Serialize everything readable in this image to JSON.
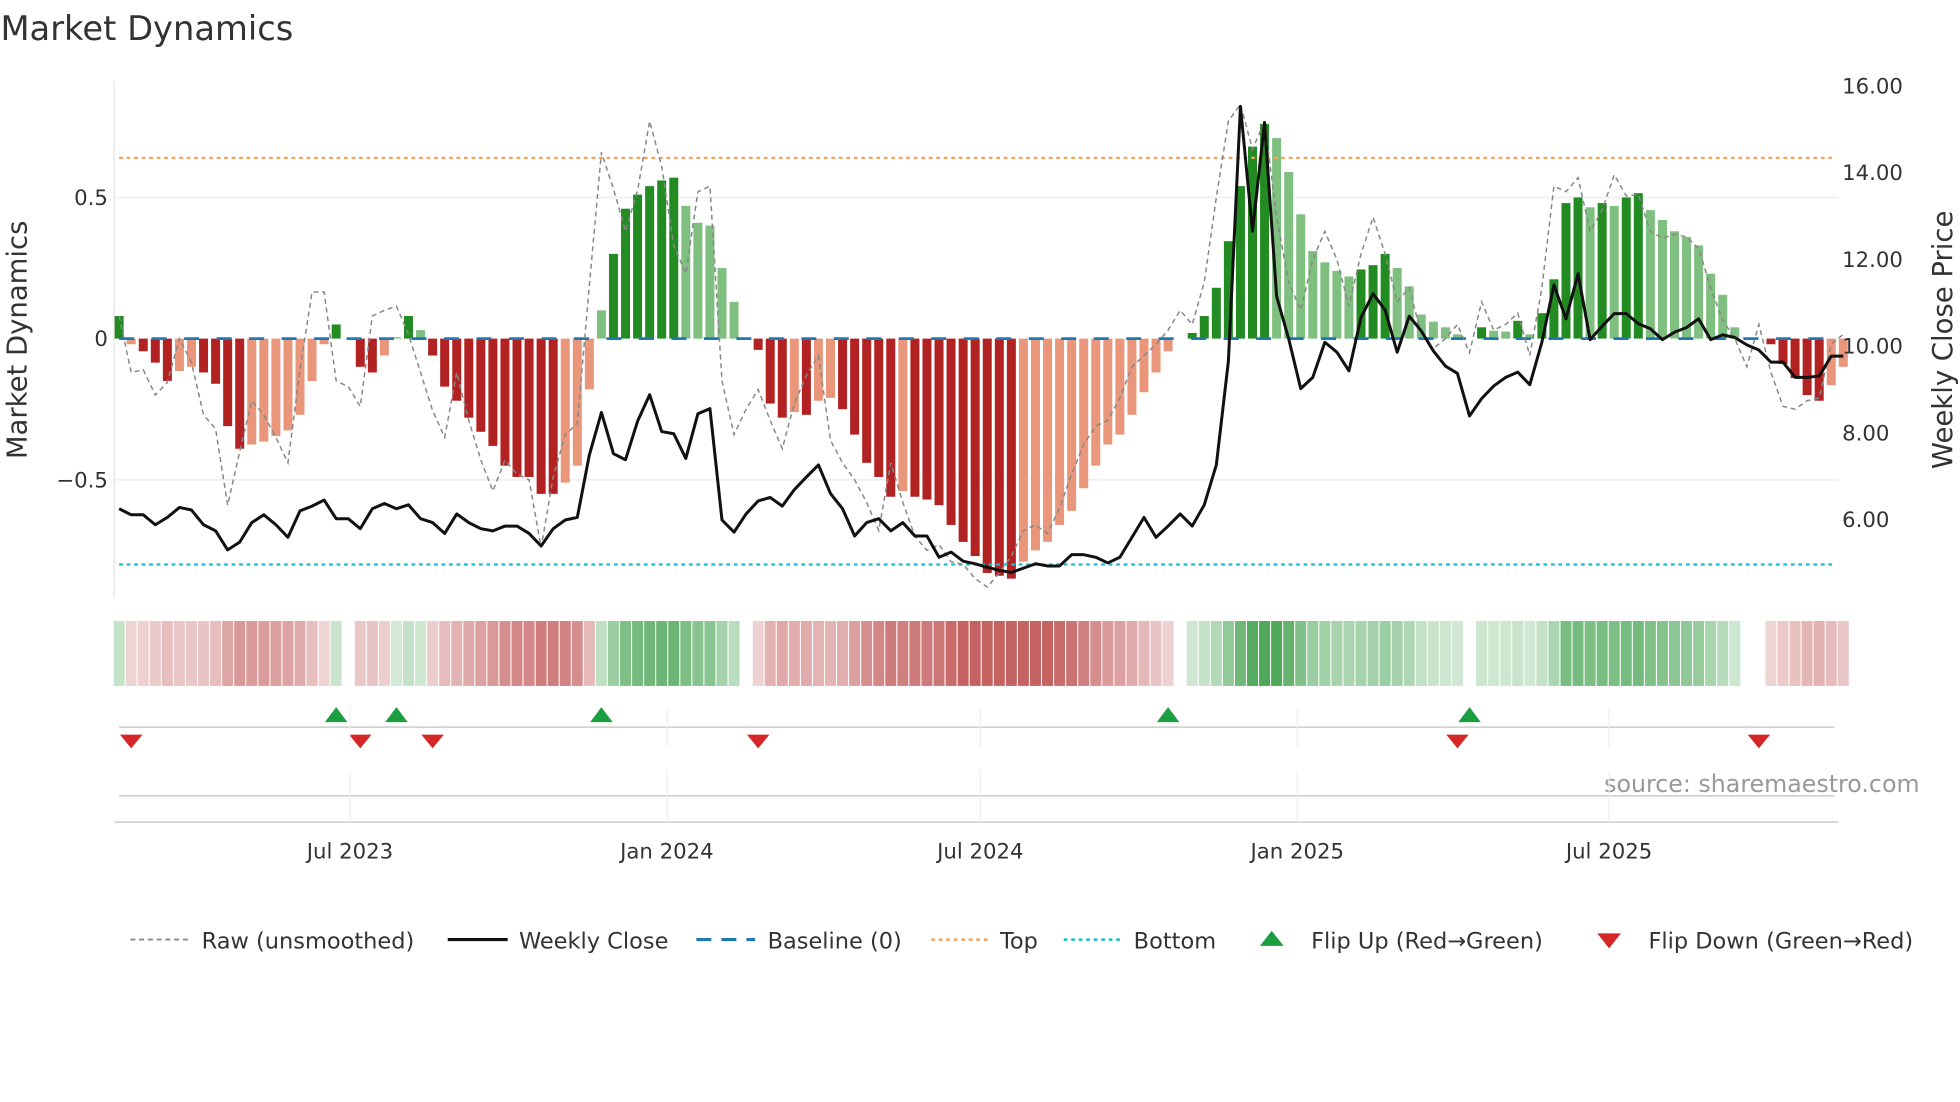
{
  "chart_data": {
    "type": "bar",
    "title": "Market Dynamics",
    "ylabel": "Market Dynamics",
    "y2label": "Weekly Close Price",
    "ylim": [
      -0.9,
      0.85
    ],
    "y2lim": [
      4.3,
      16.2
    ],
    "yticks": [
      {
        "v": 0.5,
        "label": "0.5"
      },
      {
        "v": 0,
        "label": "0"
      },
      {
        "v": -0.5,
        "label": "−0.5"
      }
    ],
    "y2ticks": [
      {
        "v": 16,
        "label": "16.00"
      },
      {
        "v": 14,
        "label": "14.00"
      },
      {
        "v": 12,
        "label": "12.00"
      },
      {
        "v": 10,
        "label": "10.00"
      },
      {
        "v": 8,
        "label": "8.00"
      },
      {
        "v": 6,
        "label": "6.00"
      }
    ],
    "xticks": [
      {
        "date": "2023-07-01",
        "label": "Jul 2023"
      },
      {
        "date": "2024-01-01",
        "label": "Jan 2024"
      },
      {
        "date": "2024-07-01",
        "label": "Jul 2024"
      },
      {
        "date": "2025-01-01",
        "label": "Jan 2025"
      },
      {
        "date": "2025-07-01",
        "label": "Jul 2025"
      }
    ],
    "start_date": "2023-02-17",
    "frequency": "weekly",
    "top_level": 0.64,
    "bottom_level": -0.8,
    "baseline": 0,
    "dynamics": [
      0.08,
      -0.02,
      -0.045,
      -0.085,
      -0.15,
      -0.115,
      -0.1,
      -0.12,
      -0.16,
      -0.31,
      -0.39,
      -0.375,
      -0.365,
      -0.345,
      -0.325,
      -0.27,
      -0.15,
      -0.02,
      0.05,
      0.0,
      -0.1,
      -0.12,
      -0.06,
      0.005,
      0.08,
      0.03,
      -0.06,
      -0.17,
      -0.22,
      -0.28,
      -0.33,
      -0.38,
      -0.45,
      -0.49,
      -0.49,
      -0.55,
      -0.55,
      -0.51,
      -0.45,
      -0.18,
      0.1,
      0.3,
      0.46,
      0.51,
      0.54,
      0.56,
      0.57,
      0.47,
      0.41,
      0.4,
      0.25,
      0.13,
      0.0,
      -0.04,
      -0.23,
      -0.28,
      -0.26,
      -0.27,
      -0.22,
      -0.21,
      -0.25,
      -0.34,
      -0.44,
      -0.49,
      -0.56,
      -0.54,
      -0.56,
      -0.57,
      -0.59,
      -0.66,
      -0.72,
      -0.77,
      -0.83,
      -0.84,
      -0.85,
      -0.79,
      -0.75,
      -0.72,
      -0.66,
      -0.61,
      -0.53,
      -0.45,
      -0.375,
      -0.34,
      -0.27,
      -0.19,
      -0.12,
      -0.045,
      0.0,
      0.02,
      0.08,
      0.18,
      0.345,
      0.54,
      0.68,
      0.76,
      0.71,
      0.59,
      0.44,
      0.31,
      0.27,
      0.24,
      0.22,
      0.245,
      0.26,
      0.3,
      0.25,
      0.185,
      0.085,
      0.06,
      0.04,
      0.015,
      0.0,
      0.04,
      0.028,
      0.025,
      0.063,
      0.015,
      0.09,
      0.21,
      0.48,
      0.5,
      0.465,
      0.48,
      0.47,
      0.5,
      0.515,
      0.455,
      0.42,
      0.38,
      0.36,
      0.33,
      0.23,
      0.155,
      0.04,
      0.0,
      0.0,
      -0.02,
      -0.09,
      -0.14,
      -0.2,
      -0.22,
      -0.165,
      -0.1
    ],
    "raw": [
      0.08,
      -0.12,
      -0.11,
      -0.2,
      -0.155,
      0.0,
      -0.085,
      -0.27,
      -0.32,
      -0.59,
      -0.4,
      -0.22,
      -0.27,
      -0.35,
      -0.44,
      -0.11,
      0.165,
      0.165,
      -0.15,
      -0.17,
      -0.24,
      0.08,
      0.1,
      0.115,
      0.015,
      -0.12,
      -0.255,
      -0.35,
      -0.12,
      -0.29,
      -0.43,
      -0.54,
      -0.43,
      -0.48,
      -0.5,
      -0.74,
      -0.49,
      -0.34,
      -0.3,
      0.19,
      0.66,
      0.53,
      0.38,
      0.525,
      0.77,
      0.61,
      0.33,
      0.23,
      0.52,
      0.54,
      -0.15,
      -0.34,
      -0.25,
      -0.18,
      -0.29,
      -0.39,
      -0.23,
      -0.13,
      -0.06,
      -0.36,
      -0.44,
      -0.5,
      -0.58,
      -0.68,
      -0.44,
      -0.58,
      -0.7,
      -0.75,
      -0.73,
      -0.79,
      -0.8,
      -0.85,
      -0.88,
      -0.83,
      -0.77,
      -0.68,
      -0.66,
      -0.69,
      -0.6,
      -0.48,
      -0.375,
      -0.31,
      -0.29,
      -0.21,
      -0.1,
      -0.06,
      -0.02,
      0.03,
      0.1,
      0.05,
      0.2,
      0.5,
      0.77,
      0.83,
      0.67,
      0.77,
      0.43,
      0.2,
      0.1,
      0.28,
      0.38,
      0.28,
      0.115,
      0.3,
      0.43,
      0.3,
      0.13,
      0.18,
      0.015,
      -0.035,
      0.0,
      0.05,
      -0.05,
      0.13,
      0.03,
      0.05,
      0.09,
      -0.06,
      0.18,
      0.54,
      0.52,
      0.57,
      0.38,
      0.455,
      0.58,
      0.505,
      0.51,
      0.38,
      0.355,
      0.37,
      0.36,
      0.32,
      0.18,
      0.065,
      0.0,
      -0.1,
      0.05,
      -0.12,
      -0.24,
      -0.25,
      -0.22,
      -0.21,
      -0.02,
      0.015
    ],
    "close": [
      6.22,
      6.08,
      6.08,
      5.85,
      6.02,
      6.25,
      6.19,
      5.85,
      5.71,
      5.27,
      5.45,
      5.9,
      6.08,
      5.85,
      5.56,
      6.17,
      6.28,
      6.42,
      5.99,
      5.99,
      5.76,
      6.22,
      6.34,
      6.22,
      6.31,
      5.99,
      5.9,
      5.65,
      6.1,
      5.9,
      5.76,
      5.71,
      5.82,
      5.82,
      5.65,
      5.36,
      5.76,
      5.96,
      6.02,
      7.46,
      8.44,
      7.49,
      7.35,
      8.24,
      8.85,
      8.0,
      7.95,
      7.38,
      8.41,
      8.53,
      5.96,
      5.68,
      6.1,
      6.4,
      6.48,
      6.28,
      6.66,
      6.95,
      7.23,
      6.57,
      6.22,
      5.59,
      5.9,
      5.99,
      5.71,
      5.9,
      5.59,
      5.59,
      5.1,
      5.22,
      5.01,
      4.95,
      4.87,
      4.8,
      4.75,
      4.85,
      4.95,
      4.9,
      4.9,
      5.16,
      5.16,
      5.1,
      4.97,
      5.1,
      5.56,
      6.02,
      5.56,
      5.82,
      6.1,
      5.82,
      6.31,
      7.23,
      9.62,
      15.5,
      12.62,
      15.13,
      11.12,
      10.14,
      8.99,
      9.25,
      10.06,
      9.83,
      9.4,
      10.63,
      11.18,
      10.8,
      9.83,
      10.66,
      10.32,
      9.86,
      9.51,
      9.34,
      8.36,
      8.76,
      9.05,
      9.25,
      9.37,
      9.08,
      10.06,
      11.38,
      10.6,
      11.64,
      10.12,
      10.43,
      10.72,
      10.72,
      10.49,
      10.37,
      10.12,
      10.29,
      10.4,
      10.6,
      10.12,
      10.23,
      10.17,
      10.0,
      9.88,
      9.6,
      9.6,
      9.25,
      9.25,
      9.28,
      9.74,
      9.74
    ],
    "flip_up": [
      "2023-06-23",
      "2023-07-28",
      "2023-11-24",
      "2024-10-18",
      "2025-04-11"
    ],
    "flip_down": [
      "2023-02-24",
      "2023-07-07",
      "2023-08-18",
      "2024-02-23",
      "2025-04-04",
      "2025-09-26"
    ],
    "legend": {
      "position": "bottom",
      "items": [
        "Raw (unsmoothed)",
        "Weekly Close",
        "Baseline (0)",
        "Top",
        "Bottom",
        "Flip Up (Red→Green)",
        "Flip Down (Green→Red)"
      ]
    },
    "source": "source: sharemaestro.com",
    "colors": {
      "pos_strong": "#228b22",
      "pos_weak": "#7fbf7f",
      "neg_strong": "#b22222",
      "neg_weak": "#e9967a",
      "close": "#111111",
      "raw": "#888888",
      "baseline": "#1f77b4",
      "top": "#f4a460",
      "bottom": "#17becf",
      "flip_up": "#1a9e3f",
      "flip_down": "#d62728"
    }
  }
}
